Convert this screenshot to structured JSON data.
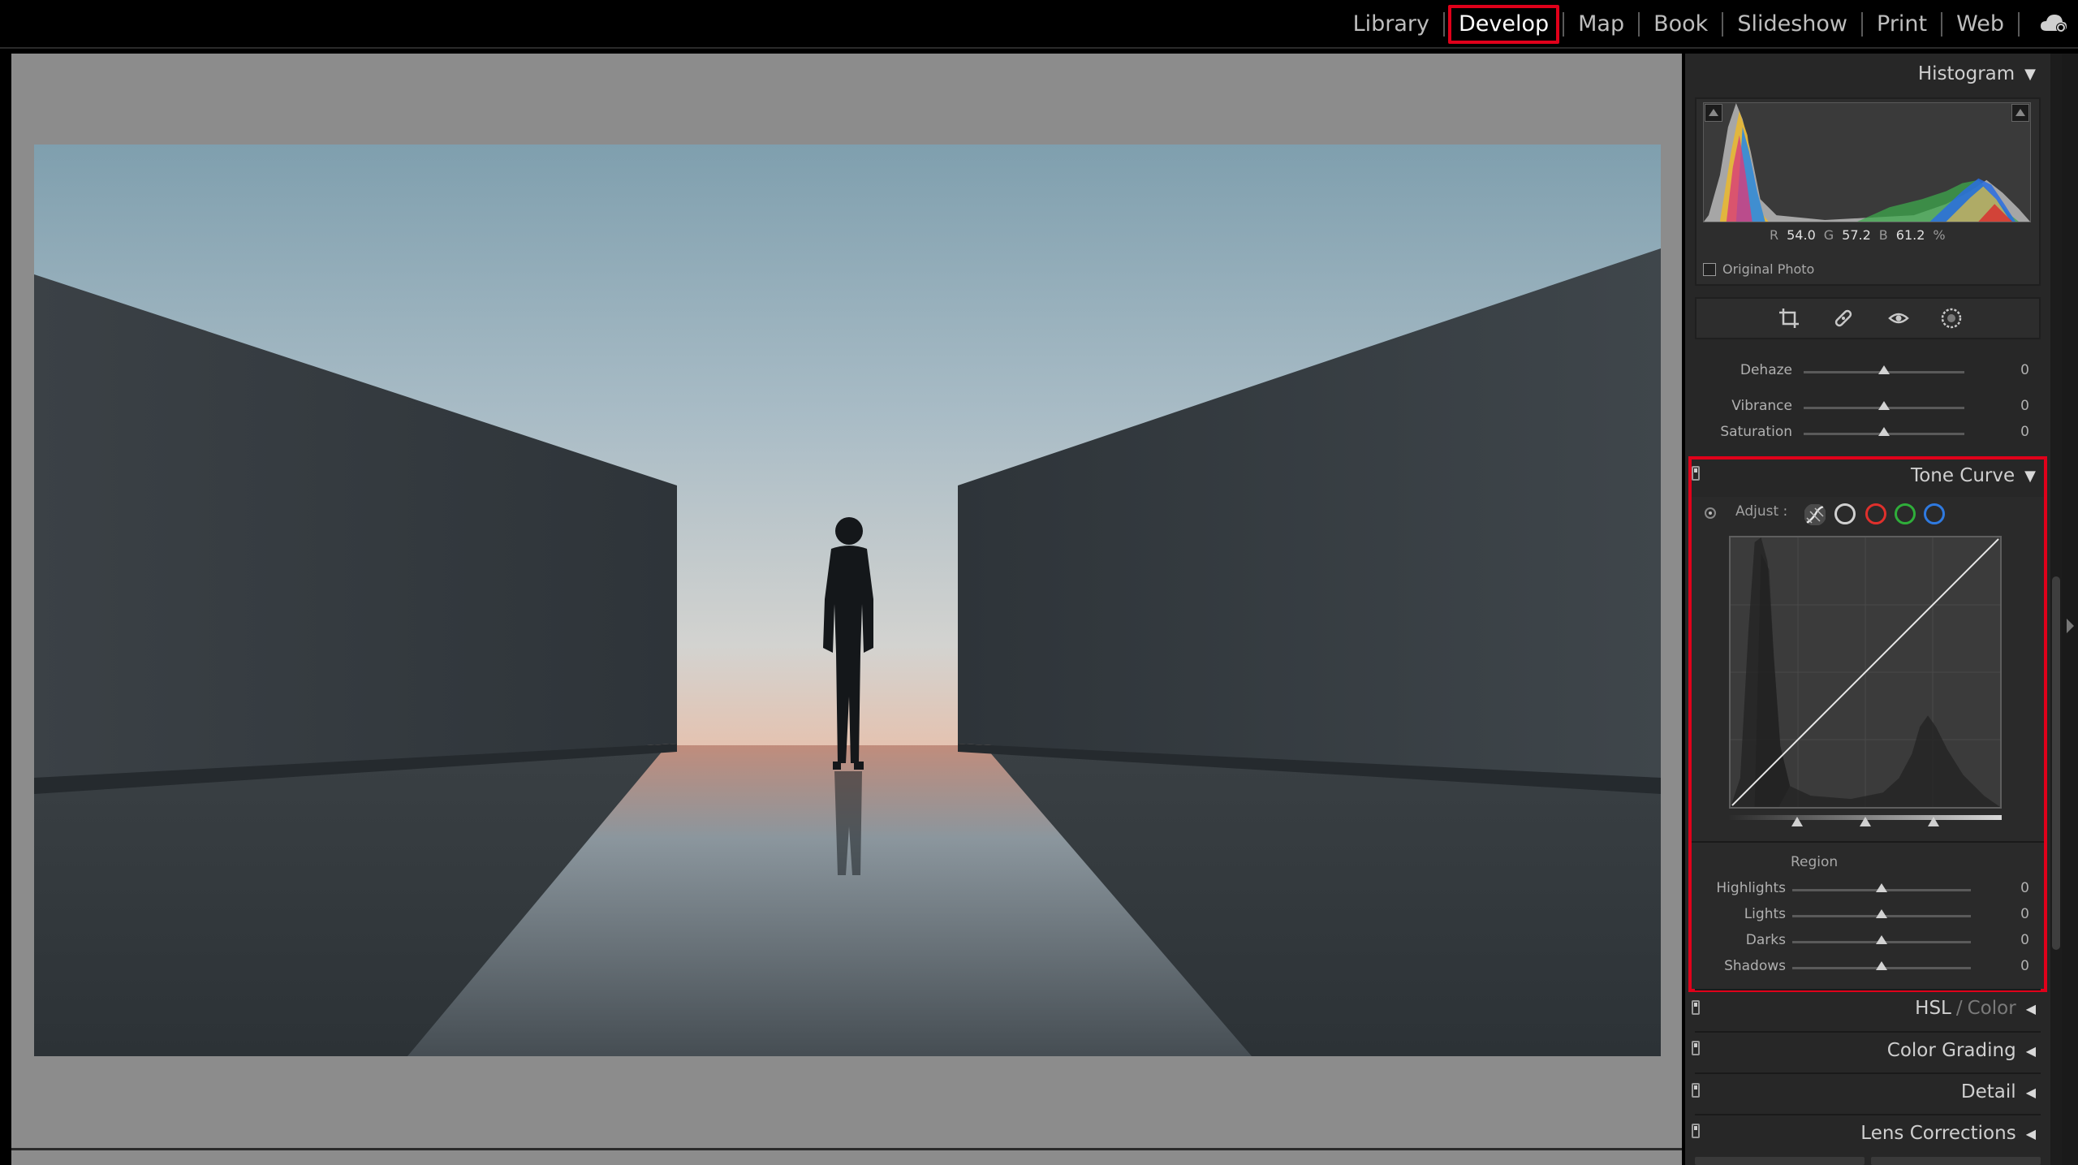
{
  "modules": {
    "items": [
      "Library",
      "Develop",
      "Map",
      "Book",
      "Slideshow",
      "Print",
      "Web"
    ],
    "active": "Develop"
  },
  "histogram": {
    "title": "Histogram",
    "r_label": "R",
    "r_value": "54.0",
    "g_label": "G",
    "g_value": "57.2",
    "b_label": "B",
    "b_value": "61.2",
    "unit": "%",
    "original_photo_label": "Original Photo"
  },
  "tools": [
    "crop-overlay-icon",
    "spot-removal-icon",
    "red-eye-icon",
    "masking-icon"
  ],
  "basic": {
    "dehaze": {
      "label": "Dehaze",
      "value": "0",
      "level": 0.5
    },
    "vibrance": {
      "label": "Vibrance",
      "value": "0",
      "level": 0.5
    },
    "saturation": {
      "label": "Saturation",
      "value": "0",
      "level": 0.5
    }
  },
  "tone_curve": {
    "title": "Tone Curve",
    "adjust_label": "Adjust :",
    "channels": [
      {
        "name": "parametric",
        "color": "#cfcfcf"
      },
      {
        "name": "rgb",
        "color": "#d0d0d0"
      },
      {
        "name": "red",
        "color": "#e0302c"
      },
      {
        "name": "green",
        "color": "#2fae3a"
      },
      {
        "name": "blue",
        "color": "#2f7ae0"
      }
    ],
    "split_points": [
      0.25,
      0.5,
      0.75
    ],
    "region_label": "Region",
    "highlights": {
      "label": "Highlights",
      "value": "0",
      "level": 0.5
    },
    "lights": {
      "label": "Lights",
      "value": "0",
      "level": 0.5
    },
    "darks": {
      "label": "Darks",
      "value": "0",
      "level": 0.5
    },
    "shadows": {
      "label": "Shadows",
      "value": "0",
      "level": 0.5
    }
  },
  "panels": {
    "hsl": "HSL",
    "hsl_slash": "/",
    "color": "Color",
    "color_grading": "Color Grading",
    "detail": "Detail",
    "lens_corrections": "Lens Corrections"
  },
  "colors": {
    "highlight_box": "#e0001a",
    "panel_bg": "#272727",
    "canvas_bg": "#8c8c8c"
  }
}
